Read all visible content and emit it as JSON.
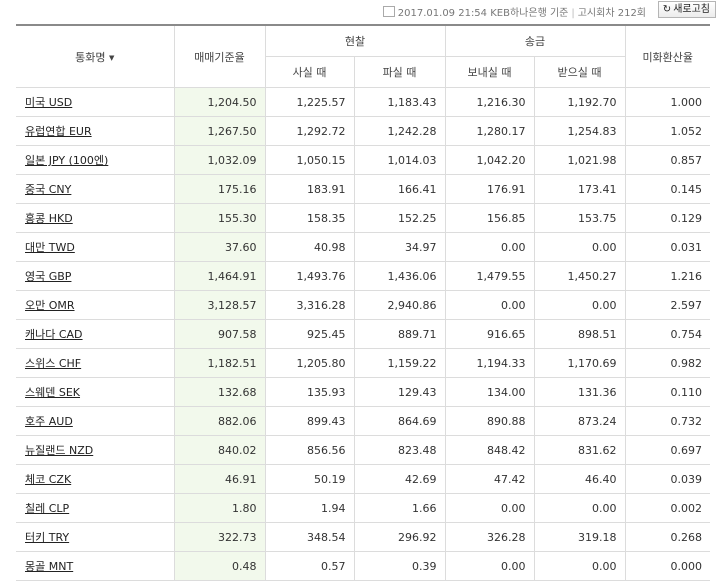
{
  "header_info": {
    "date_time": "2017.01.09 21:54",
    "bank": "KEB하나은행 기준",
    "notice": "고시회차 212회"
  },
  "refresh_label": "새로고침",
  "columns": {
    "currency": "통화명",
    "base_rate": "매매기준율",
    "cash": "현찰",
    "cash_buy": "사실 때",
    "cash_sell": "파실 때",
    "transfer": "송금",
    "transfer_send": "보내실 때",
    "transfer_receive": "받으실 때",
    "usd_rate": "미화환산율"
  },
  "rows": [
    {
      "name": "미국 USD",
      "base": "1,204.50",
      "buy": "1,225.57",
      "sell": "1,183.43",
      "send": "1,216.30",
      "recv": "1,192.70",
      "usd": "1.000"
    },
    {
      "name": "유럽연합 EUR",
      "base": "1,267.50",
      "buy": "1,292.72",
      "sell": "1,242.28",
      "send": "1,280.17",
      "recv": "1,254.83",
      "usd": "1.052"
    },
    {
      "name": "일본 JPY (100엔)",
      "base": "1,032.09",
      "buy": "1,050.15",
      "sell": "1,014.03",
      "send": "1,042.20",
      "recv": "1,021.98",
      "usd": "0.857"
    },
    {
      "name": "중국 CNY",
      "base": "175.16",
      "buy": "183.91",
      "sell": "166.41",
      "send": "176.91",
      "recv": "173.41",
      "usd": "0.145"
    },
    {
      "name": "홍콩 HKD",
      "base": "155.30",
      "buy": "158.35",
      "sell": "152.25",
      "send": "156.85",
      "recv": "153.75",
      "usd": "0.129"
    },
    {
      "name": "대만 TWD",
      "base": "37.60",
      "buy": "40.98",
      "sell": "34.97",
      "send": "0.00",
      "recv": "0.00",
      "usd": "0.031"
    },
    {
      "name": "영국 GBP",
      "base": "1,464.91",
      "buy": "1,493.76",
      "sell": "1,436.06",
      "send": "1,479.55",
      "recv": "1,450.27",
      "usd": "1.216"
    },
    {
      "name": "오만 OMR",
      "base": "3,128.57",
      "buy": "3,316.28",
      "sell": "2,940.86",
      "send": "0.00",
      "recv": "0.00",
      "usd": "2.597"
    },
    {
      "name": "캐나다 CAD",
      "base": "907.58",
      "buy": "925.45",
      "sell": "889.71",
      "send": "916.65",
      "recv": "898.51",
      "usd": "0.754"
    },
    {
      "name": "스위스 CHF",
      "base": "1,182.51",
      "buy": "1,205.80",
      "sell": "1,159.22",
      "send": "1,194.33",
      "recv": "1,170.69",
      "usd": "0.982"
    },
    {
      "name": "스웨덴 SEK",
      "base": "132.68",
      "buy": "135.93",
      "sell": "129.43",
      "send": "134.00",
      "recv": "131.36",
      "usd": "0.110"
    },
    {
      "name": "호주 AUD",
      "base": "882.06",
      "buy": "899.43",
      "sell": "864.69",
      "send": "890.88",
      "recv": "873.24",
      "usd": "0.732"
    },
    {
      "name": "뉴질랜드 NZD",
      "base": "840.02",
      "buy": "856.56",
      "sell": "823.48",
      "send": "848.42",
      "recv": "831.62",
      "usd": "0.697"
    },
    {
      "name": "체코 CZK",
      "base": "46.91",
      "buy": "50.19",
      "sell": "42.69",
      "send": "47.42",
      "recv": "46.40",
      "usd": "0.039"
    },
    {
      "name": "칠레 CLP",
      "base": "1.80",
      "buy": "1.94",
      "sell": "1.66",
      "send": "0.00",
      "recv": "0.00",
      "usd": "0.002"
    },
    {
      "name": "터키 TRY",
      "base": "322.73",
      "buy": "348.54",
      "sell": "296.92",
      "send": "326.28",
      "recv": "319.18",
      "usd": "0.268"
    },
    {
      "name": "몽골 MNT",
      "base": "0.48",
      "buy": "0.57",
      "sell": "0.39",
      "send": "0.00",
      "recv": "0.00",
      "usd": "0.000"
    }
  ]
}
